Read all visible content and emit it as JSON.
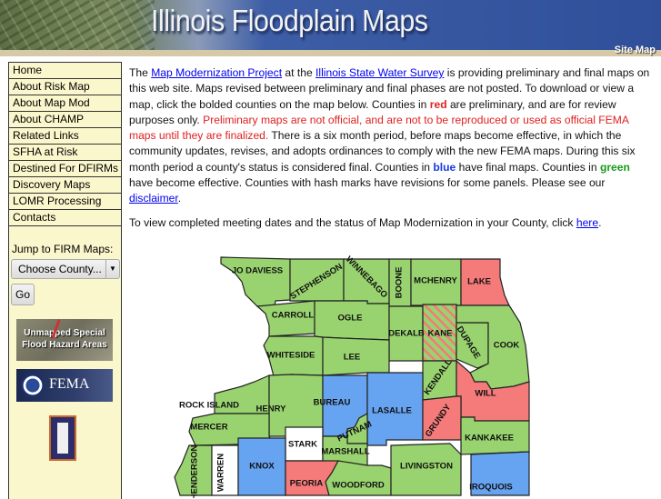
{
  "header": {
    "title": "Illinois Floodplain Maps",
    "site_map_label": "Site Map"
  },
  "sidebar": {
    "items": [
      {
        "label": "Home"
      },
      {
        "label": "About Risk Map"
      },
      {
        "label": "About Map Mod"
      },
      {
        "label": "About CHAMP"
      },
      {
        "label": "Related Links"
      },
      {
        "label": "SFHA at Risk"
      },
      {
        "label": "Destined For DFIRMs"
      },
      {
        "label": "Discovery Maps"
      },
      {
        "label": "LOMR Processing"
      },
      {
        "label": "Contacts"
      }
    ],
    "jump_label": "Jump to FIRM Maps:",
    "county_select_value": "Choose County...",
    "go_label": "Go",
    "badges": {
      "unmapped_line1": "Unmapped Special",
      "unmapped_line2": "Flood Hazard Areas",
      "fema": "FEMA"
    }
  },
  "content": {
    "p1": {
      "t1": "The ",
      "link1": "Map Modernization Project",
      "t2": " at the ",
      "link2": "Illinois State Water Survey",
      "t3": " is providing preliminary and final maps on this web site. Maps revised between preliminary and final phases are not posted. To download or view a map, click the bolded counties on the map below. Counties in ",
      "red_word": "red",
      "t4": " are preliminary, and are for review purposes only. ",
      "red_sentence": "Preliminary maps are not official, and are not to be reproduced or used as official FEMA maps until they are finalized.",
      "t5": " There is a six month period, before maps become effective, in which the community updates, revises, and adopts ordinances to comply with the new FEMA maps. During this six month period a county's status is considered final. Counties in ",
      "blue_word": "blue",
      "t6": " have final maps. Counties in ",
      "green_word": "green",
      "t7": " have become effective. Counties with hash marks have revisions for some panels. Please see our ",
      "link3": "disclaimer",
      "t8": "."
    },
    "p2": {
      "t1": "To view completed meeting dates and the status of Map Modernization in your County, click ",
      "link": "here",
      "t2": "."
    }
  },
  "map": {
    "colors": {
      "effective": "#99d36f",
      "preliminary": "#f57a7a",
      "final": "#66a3f0",
      "none": "#ffffff",
      "border": "#222222"
    },
    "counties": {
      "jo_daviess": {
        "label": "JO DAVIESS",
        "status": "effective"
      },
      "stephenson": {
        "label": "STEPHENSON",
        "status": "effective"
      },
      "winnebago": {
        "label": "WINNEBAGO",
        "status": "effective"
      },
      "boone": {
        "label": "BOONE",
        "status": "effective"
      },
      "mchenry": {
        "label": "MCHENRY",
        "status": "effective"
      },
      "lake": {
        "label": "LAKE",
        "status": "preliminary"
      },
      "carroll": {
        "label": "CARROLL",
        "status": "effective"
      },
      "ogle": {
        "label": "OGLE",
        "status": "effective"
      },
      "dekalb": {
        "label": "DEKALB",
        "status": "effective"
      },
      "kane": {
        "label": "KANE",
        "status": "effective",
        "hashed": true
      },
      "dupage": {
        "label": "DUPAGE",
        "status": "effective"
      },
      "cook": {
        "label": "COOK",
        "status": "effective"
      },
      "whiteside": {
        "label": "WHITESIDE",
        "status": "effective"
      },
      "lee": {
        "label": "LEE",
        "status": "effective"
      },
      "kendall": {
        "label": "KENDALL",
        "status": "effective"
      },
      "will": {
        "label": "WILL",
        "status": "preliminary"
      },
      "rock_island": {
        "label": "ROCK ISLAND",
        "status": "effective"
      },
      "henry": {
        "label": "HENRY",
        "status": "effective"
      },
      "bureau": {
        "label": "BUREAU",
        "status": "final"
      },
      "lasalle": {
        "label": "LASALLE",
        "status": "final"
      },
      "grundy": {
        "label": "GRUNDY",
        "status": "preliminary"
      },
      "mercer": {
        "label": "MERCER",
        "status": "effective"
      },
      "putnam": {
        "label": "PUTNAM",
        "status": "effective"
      },
      "kankakee": {
        "label": "KANKAKEE",
        "status": "effective"
      },
      "stark": {
        "label": "STARK",
        "status": "none"
      },
      "marshall": {
        "label": "MARSHALL",
        "status": "effective"
      },
      "henderson": {
        "label": "HENDERSON",
        "status": "effective"
      },
      "warren": {
        "label": "WARREN",
        "status": "none"
      },
      "knox": {
        "label": "KNOX",
        "status": "final"
      },
      "peoria": {
        "label": "PEORIA",
        "status": "preliminary"
      },
      "woodford": {
        "label": "WOODFORD",
        "status": "effective"
      },
      "livingston": {
        "label": "LIVINGSTON",
        "status": "effective"
      },
      "iroquois": {
        "label": "IROQUOIS",
        "status": "final"
      }
    }
  }
}
